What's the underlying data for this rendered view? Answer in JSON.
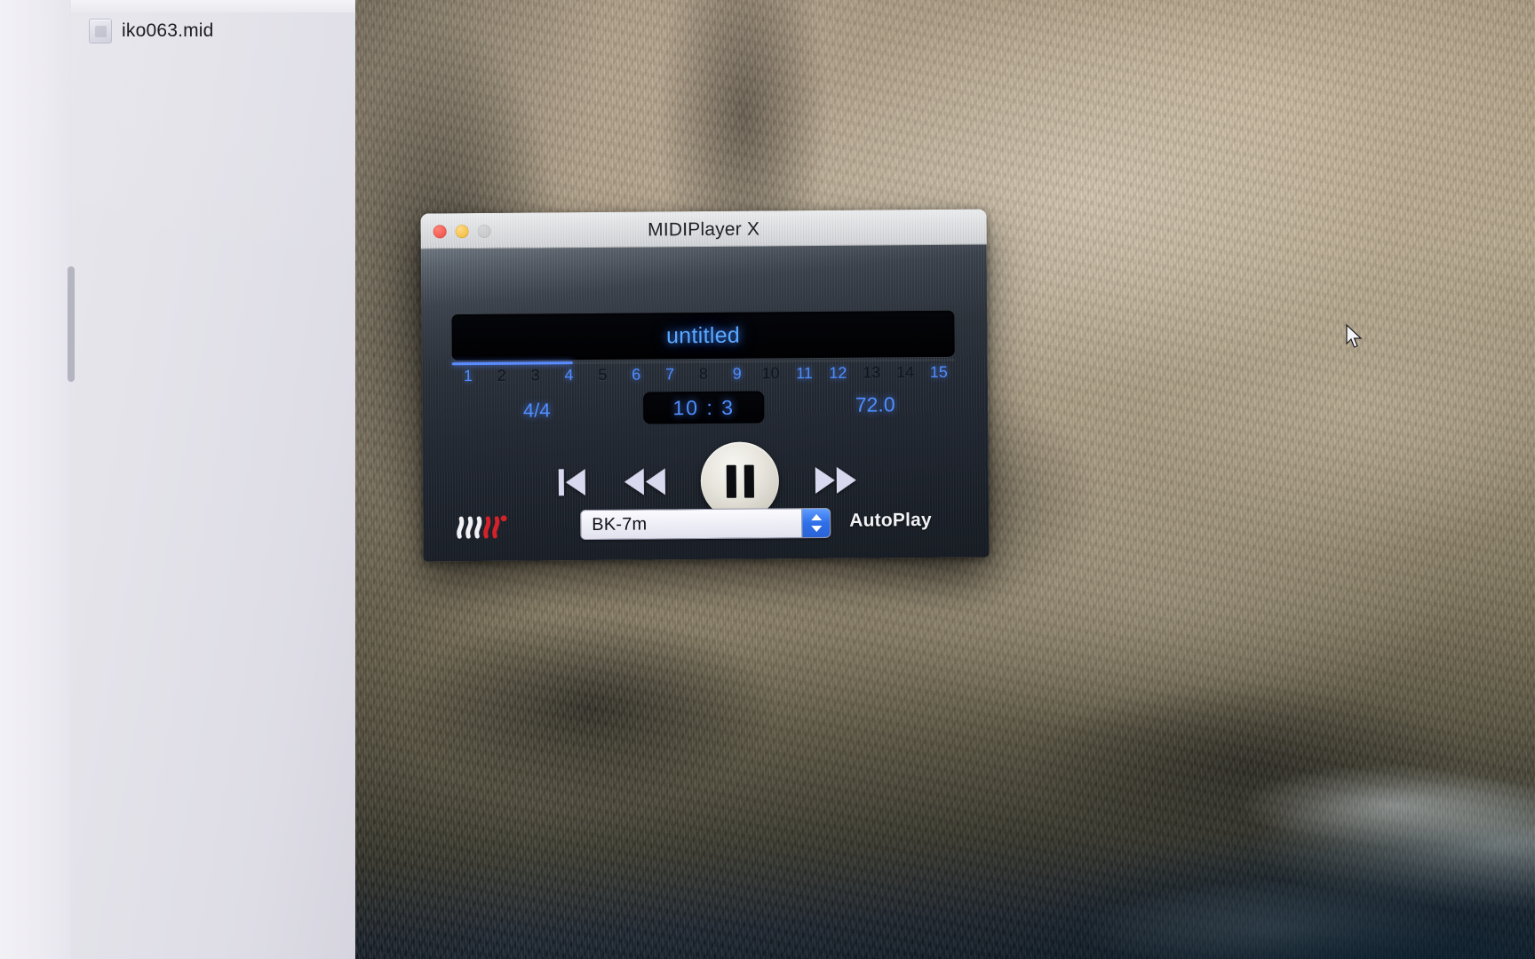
{
  "finder": {
    "file_name": "iko063.mid",
    "file_icon": "midi-file-icon"
  },
  "midi_window": {
    "title": "MIDIPlayer X",
    "traffic_lights": {
      "close": "close-button",
      "minimize": "minimize-button",
      "zoom": "zoom-button"
    },
    "song_title": "untitled",
    "progress_percent": 24,
    "measures": [
      {
        "label": "1",
        "active": true
      },
      {
        "label": "2",
        "active": false
      },
      {
        "label": "3",
        "active": false
      },
      {
        "label": "4",
        "active": true
      },
      {
        "label": "5",
        "active": false
      },
      {
        "label": "6",
        "active": true
      },
      {
        "label": "7",
        "active": true
      },
      {
        "label": "8",
        "active": false
      },
      {
        "label": "9",
        "active": true
      },
      {
        "label": "10",
        "active": false
      },
      {
        "label": "11",
        "active": true
      },
      {
        "label": "12",
        "active": true
      },
      {
        "label": "13",
        "active": false
      },
      {
        "label": "14",
        "active": false
      },
      {
        "label": "15",
        "active": true
      }
    ],
    "time_signature": "4/4",
    "position": "10 : 3",
    "tempo": "72.0",
    "transport": {
      "skip_back": "skip-to-start",
      "rewind": "rewind",
      "play_pause": "pause",
      "fast_forward": "fast-forward"
    },
    "bottom": {
      "brand_logo": "midiplayer-brand-logo",
      "device": "BK-7m",
      "autoplay_label": "AutoPlay"
    }
  },
  "colors": {
    "accent_blue": "#4f8dff",
    "display_bg": "#010103",
    "stepper_blue": "#2f6fe8",
    "logo_red": "#d4222b"
  },
  "cursor": {
    "name": "mouse-pointer"
  }
}
